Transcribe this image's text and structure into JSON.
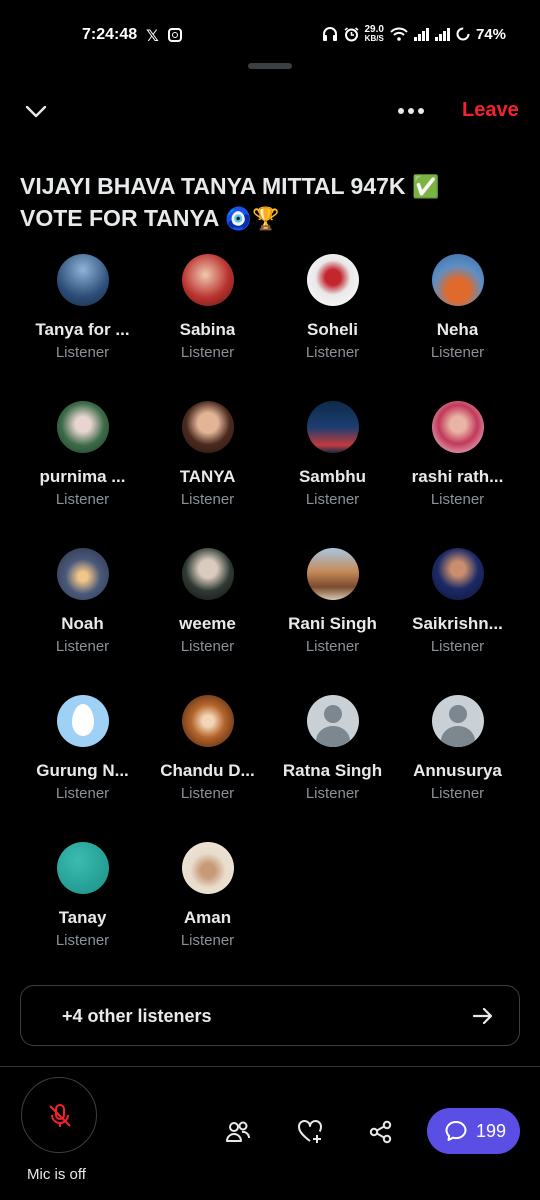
{
  "status_bar": {
    "time": "7:24:48",
    "x_app": "𝕏",
    "speed_value": "29.0",
    "speed_unit": "KB/S",
    "battery": "74%"
  },
  "header": {
    "leave_label": "Leave",
    "leave_color": "#f4212e"
  },
  "space": {
    "title_text": "VIJAYI BHAVA TANYA MITTAL 947K ",
    "title_emoji_1": "✅",
    "title_line2": "VOTE FOR TANYA ",
    "title_emoji_2": "🧿🏆"
  },
  "listeners": [
    {
      "name": "Tanya for ...",
      "role": "Listener",
      "avatar": "photo-blue"
    },
    {
      "name": "Sabina",
      "role": "Listener",
      "avatar": "photo-red"
    },
    {
      "name": "Soheli",
      "role": "Listener",
      "avatar": "photo-white-red"
    },
    {
      "name": "Neha",
      "role": "Listener",
      "avatar": "photo-sky-orange"
    },
    {
      "name": "purnima ...",
      "role": "Listener",
      "avatar": "photo-green-white"
    },
    {
      "name": "TANYA",
      "role": "Listener",
      "avatar": "photo-portrait"
    },
    {
      "name": "Sambhu",
      "role": "Listener",
      "avatar": "photo-dark-text"
    },
    {
      "name": "rashi rath...",
      "role": "Listener",
      "avatar": "photo-pink"
    },
    {
      "name": "Noah",
      "role": "Listener",
      "avatar": "photo-landscape"
    },
    {
      "name": "weeme",
      "role": "Listener",
      "avatar": "photo-dark-portrait"
    },
    {
      "name": "Rani Singh",
      "role": "Listener",
      "avatar": "photo-building"
    },
    {
      "name": "Saikrishn...",
      "role": "Listener",
      "avatar": "photo-navy-suit"
    },
    {
      "name": "Gurung N...",
      "role": "Listener",
      "avatar": "default-egg"
    },
    {
      "name": "Chandu D...",
      "role": "Listener",
      "avatar": "photo-cow"
    },
    {
      "name": "Ratna Singh",
      "role": "Listener",
      "avatar": "default-person"
    },
    {
      "name": "Annusurya",
      "role": "Listener",
      "avatar": "default-person"
    },
    {
      "name": "Tanay",
      "role": "Listener",
      "avatar": "teal-solid"
    },
    {
      "name": "Aman",
      "role": "Listener",
      "avatar": "photo-beige-child"
    }
  ],
  "other_listeners": {
    "label": "+4 other listeners"
  },
  "bottom_bar": {
    "mic_label": "Mic is off",
    "reply_count": "199",
    "reply_color": "#5b4ee5"
  }
}
